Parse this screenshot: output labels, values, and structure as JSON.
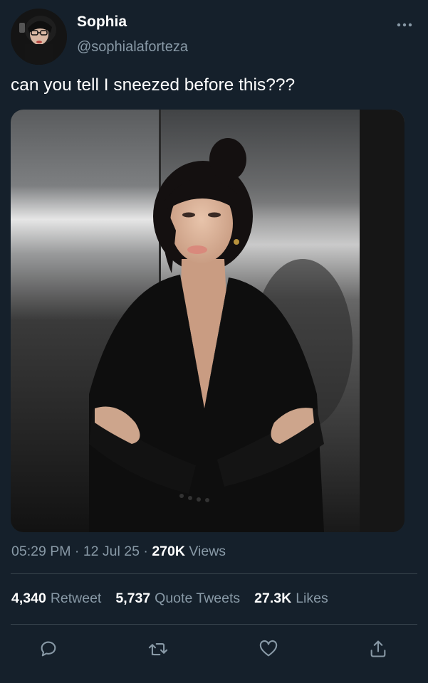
{
  "tweet": {
    "display_name": "Sophia",
    "handle": "@sophialaforteza",
    "text": "can you tell I sneezed before this???",
    "time": "05:29 PM",
    "date": "12 Jul 25",
    "views_count": "270K",
    "views_label": "Views"
  },
  "stats": [
    {
      "count": "4,340",
      "label": "Retweet"
    },
    {
      "count": "5,737",
      "label": "Quote Tweets"
    },
    {
      "count": "27.3K",
      "label": "Likes"
    }
  ],
  "icons": {
    "more": "more-horizontal-icon",
    "reply": "reply-icon",
    "retweet": "retweet-icon",
    "like": "heart-icon",
    "share": "share-icon"
  },
  "colors": {
    "background": "#15202b",
    "secondary_text": "#8899a6",
    "divider": "#38444d"
  }
}
